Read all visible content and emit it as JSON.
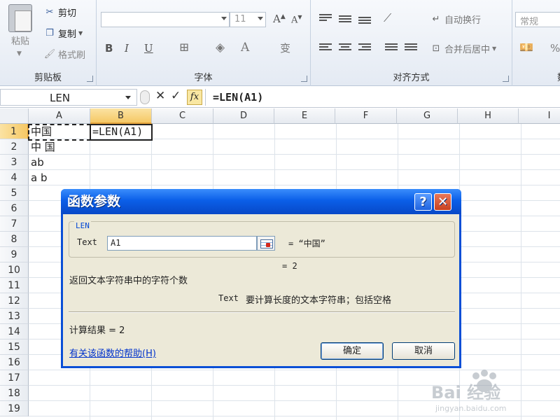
{
  "ribbon": {
    "clipboard": {
      "paste": "粘贴",
      "cut": "剪切",
      "copy": "复制",
      "format_painter": "格式刷",
      "group_label": "剪贴板"
    },
    "font": {
      "font_size": "11",
      "bold": "B",
      "italic": "I",
      "underline": "U",
      "group_label": "字体"
    },
    "alignment": {
      "wrap_text": "自动换行",
      "merge_center": "合并后居中",
      "group_label": "对齐方式"
    },
    "number": {
      "format": "常规",
      "percent": "%",
      "group_label": "数"
    }
  },
  "formula_bar": {
    "name_box": "LEN",
    "formula": "=LEN(A1)",
    "fx": "fx"
  },
  "grid": {
    "columns": [
      "A",
      "B",
      "C",
      "D",
      "E",
      "F",
      "G",
      "H",
      "I"
    ],
    "rows": [
      "1",
      "2",
      "3",
      "4",
      "5",
      "6",
      "7",
      "8",
      "9",
      "10",
      "11",
      "12",
      "13",
      "14",
      "15",
      "16",
      "17",
      "18",
      "19"
    ],
    "cells": {
      "A1": "中国",
      "B1": "=LEN(A1)",
      "A2": "中 国",
      "A3": "ab",
      "A4": "a b"
    },
    "selected_column": "B",
    "selected_row": "1"
  },
  "dialog": {
    "title": "函数参数",
    "help_glyph": "?",
    "close_glyph": "✕",
    "function_name": "LEN",
    "arg_label": "Text",
    "arg_value": "A1",
    "arg_eval": "= “中国”",
    "result_eval": "= 2",
    "description": "返回文本字符串中的字符个数",
    "arg_help_name": "Text",
    "arg_help_text": "要计算长度的文本字符串；包括空格",
    "calc_result": "计算结果 = 2",
    "help_link": "有关该函数的帮助(H)",
    "ok": "确定",
    "cancel": "取消"
  },
  "watermark": {
    "text": "Bai 经验",
    "url": "jingyan.baidu.com"
  }
}
